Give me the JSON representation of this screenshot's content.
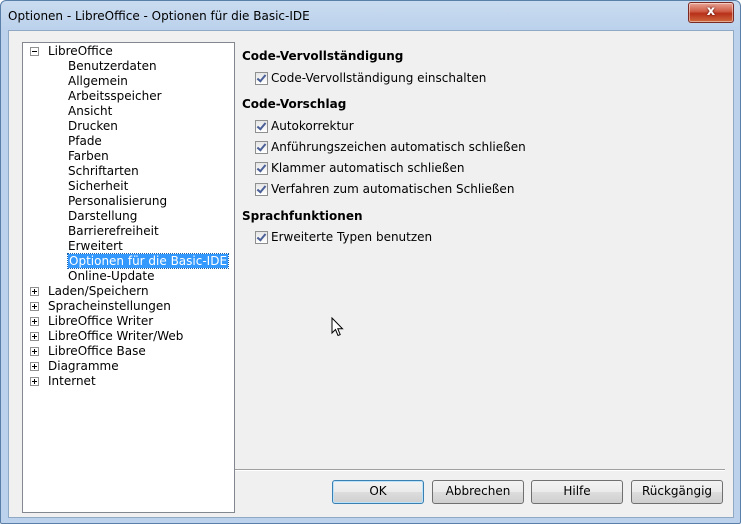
{
  "window": {
    "title": "Optionen - LibreOffice - Optionen für die Basic-IDE",
    "close_glyph": "x"
  },
  "tree": {
    "root": {
      "label": "LibreOffice",
      "expanded": true
    },
    "children": [
      "Benutzerdaten",
      "Allgemein",
      "Arbeitsspeicher",
      "Ansicht",
      "Drucken",
      "Pfade",
      "Farben",
      "Schriftarten",
      "Sicherheit",
      "Personalisierung",
      "Darstellung",
      "Barrierefreiheit",
      "Erweitert",
      "Optionen für die Basic-IDE",
      "Online-Update"
    ],
    "selected": "Optionen für die Basic-IDE",
    "collapsed_groups": [
      "Laden/Speichern",
      "Spracheinstellungen",
      "LibreOffice Writer",
      "LibreOffice Writer/Web",
      "LibreOffice Base",
      "Diagramme",
      "Internet"
    ]
  },
  "sections": [
    {
      "title": "Code-Vervollständigung",
      "options": [
        {
          "label": "Code-Vervollständigung einschalten",
          "checked": true
        }
      ]
    },
    {
      "title": "Code-Vorschlag",
      "options": [
        {
          "label": "Autokorrektur",
          "checked": true
        },
        {
          "label": "Anführungszeichen automatisch schließen",
          "checked": true
        },
        {
          "label": "Klammer automatisch schließen",
          "checked": true
        },
        {
          "label": "Verfahren zum automatischen Schließen",
          "checked": true
        }
      ]
    },
    {
      "title": "Sprachfunktionen",
      "options": [
        {
          "label": "Erweiterte Typen benutzen",
          "checked": true
        }
      ]
    }
  ],
  "buttons": {
    "ok": "OK",
    "cancel": "Abbrechen",
    "help": "Hilfe",
    "reset": "Rückgängig"
  }
}
